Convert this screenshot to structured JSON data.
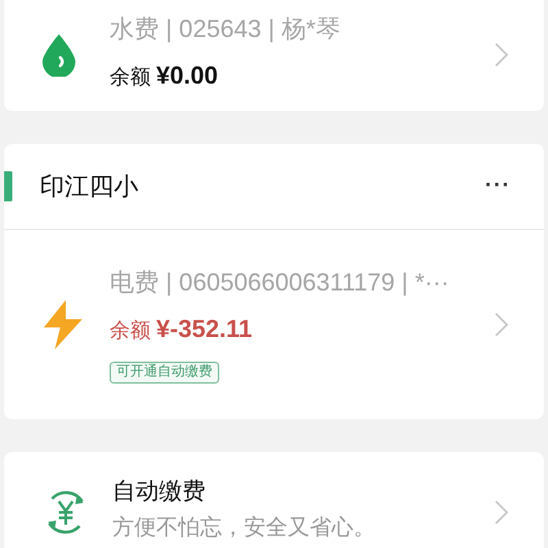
{
  "top_bill": {
    "kind": "water",
    "title": "水费 | 025643 | 杨*琴",
    "balance_label": "余额",
    "balance": "¥0.00",
    "overdue": false
  },
  "group": {
    "name": "印江四小",
    "more": "···",
    "bills": [
      {
        "kind": "electricity",
        "title": "电费 | 0605066006311179 | *···",
        "balance_label": "余额",
        "balance": "¥-352.11",
        "overdue": true,
        "tag": "可开通自动缴费"
      }
    ]
  },
  "autopay": {
    "title": "自动缴费",
    "subtitle": "方便不怕忘，安全又省心。"
  }
}
